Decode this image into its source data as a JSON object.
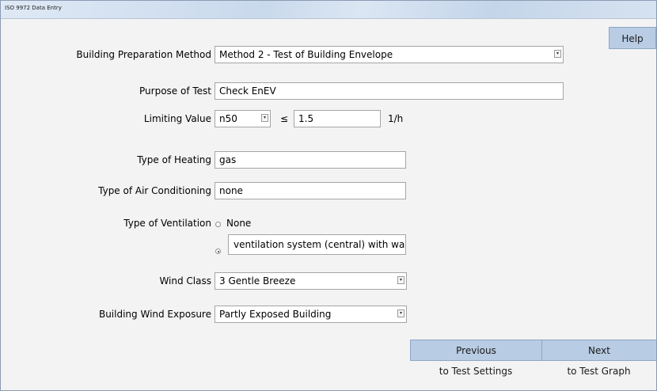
{
  "window": {
    "title": "ISO 9972 Data Entry"
  },
  "help_label": "Help",
  "form": {
    "building_prep": {
      "label": "Building Preparation Method",
      "value": "Method 2 - Test of Building Envelope"
    },
    "purpose": {
      "label": "Purpose of Test",
      "value": "Check EnEV"
    },
    "limiting": {
      "label": "Limiting Value",
      "select_value": "n50",
      "operator": "≤",
      "value": "1.5",
      "unit": "1/h"
    },
    "heating": {
      "label": "Type of Heating",
      "value": "gas"
    },
    "air_conditioning": {
      "label": "Type of Air Conditioning",
      "value": "none"
    },
    "ventilation": {
      "label": "Type of Ventilation",
      "option_none": "None",
      "option_custom_value": "ventilation system (central) with wa",
      "selected": "custom"
    },
    "wind_class": {
      "label": "Wind Class",
      "value": "3  Gentle Breeze"
    },
    "wind_exposure": {
      "label": "Building Wind Exposure",
      "value": "Partly Exposed Building"
    }
  },
  "nav": {
    "previous": {
      "label": "Previous",
      "sub": "to Test Settings"
    },
    "next": {
      "label": "Next",
      "sub": "to Test Graph"
    }
  },
  "icons": {
    "dropdown": "chevron-down-icon",
    "radio": "radio-icon"
  }
}
